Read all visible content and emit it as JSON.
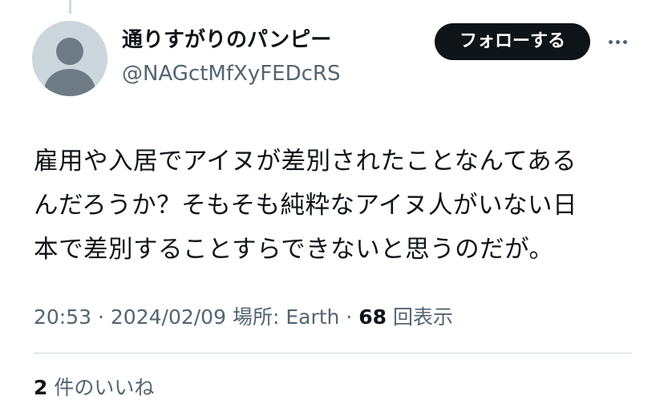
{
  "author": {
    "display_name": "通りすがりのパンピー",
    "handle": "@NAGctMfXyFEDcRS",
    "avatar_icon": "default-avatar-icon"
  },
  "follow_button_label": "フォローする",
  "more_icon": "more-horizontal-icon",
  "tweet": {
    "text_lines": [
      "雇用や入居でアイヌが差別されたことなんてある",
      "んだろうか？そもそも純粋なアイヌ人がいない日",
      "本で差別することすらできないと思うのだが。"
    ]
  },
  "meta": {
    "time": "20:53",
    "separator": "·",
    "date": "2024/02/09",
    "location_label": "場所:",
    "location": "Earth",
    "views_count": "68",
    "views_label": "回表示"
  },
  "likes": {
    "count": "2",
    "label": "件のいいね"
  },
  "colors": {
    "text_primary": "#0f1419",
    "text_secondary": "#536471",
    "divider": "#cfd9de",
    "avatar_bg": "#ccd6dd",
    "avatar_figure": "#6e7b85",
    "button_bg": "#0f1419",
    "button_text": "#ffffff"
  }
}
